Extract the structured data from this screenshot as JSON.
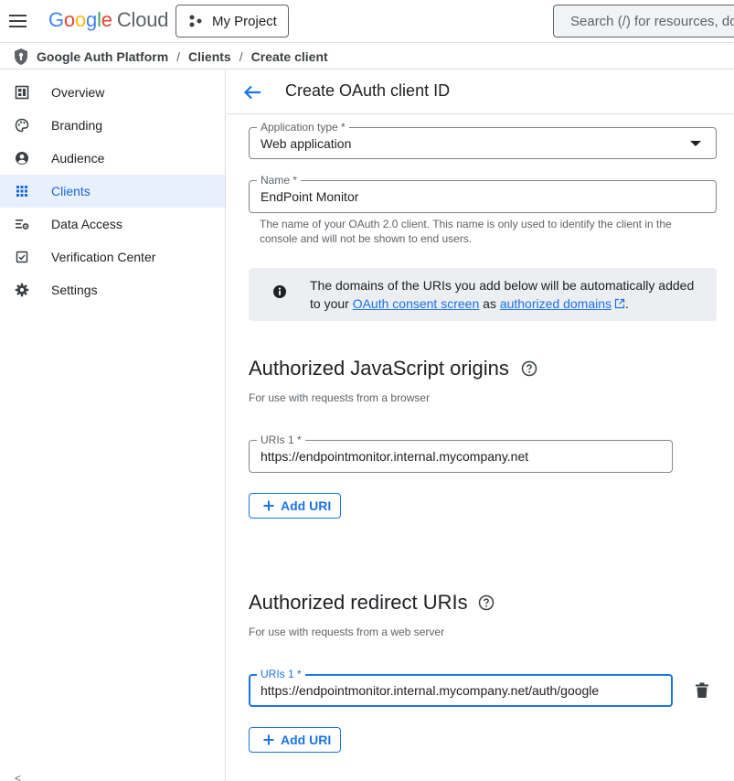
{
  "topbar": {
    "menu_icon": "hamburger-menu-icon",
    "logo_letters": [
      "G",
      "o",
      "o",
      "g",
      "l",
      "e"
    ],
    "logo_product": "Cloud",
    "project_label": "My Project",
    "search_placeholder": "Search (/) for resources, docs"
  },
  "breadcrumb": {
    "items": [
      "Google Auth Platform",
      "Clients",
      "Create client"
    ],
    "separator": "/"
  },
  "sidebar": {
    "items": [
      {
        "label": "Overview",
        "icon": "dashboard-icon",
        "active": false
      },
      {
        "label": "Branding",
        "icon": "palette-icon",
        "active": false
      },
      {
        "label": "Audience",
        "icon": "account-circle-icon",
        "active": false
      },
      {
        "label": "Clients",
        "icon": "apps-grid-icon",
        "active": true
      },
      {
        "label": "Data Access",
        "icon": "tune-settings-icon",
        "active": false
      },
      {
        "label": "Verification Center",
        "icon": "verified-checkbox-icon",
        "active": false
      },
      {
        "label": "Settings",
        "icon": "gear-icon",
        "active": false
      }
    ],
    "collapse_glyph": "<"
  },
  "page": {
    "title": "Create OAuth client ID"
  },
  "form": {
    "app_type": {
      "label": "Application type *",
      "value": "Web application"
    },
    "name": {
      "label": "Name *",
      "value": "EndPoint Monitor",
      "helper_line1": "The name of your OAuth 2.0 client. This name is only used to identify the client in the",
      "helper_line2": "console and will not be shown to end users."
    },
    "info": {
      "line1": "The domains of the URIs you add below will be automatically added",
      "line2_prefix": "to your ",
      "link1": "OAuth consent screen",
      "middle": " as ",
      "link2": "authorized domains",
      "suffix": "."
    },
    "js_origins": {
      "title": "Authorized JavaScript origins",
      "subtitle": "For use with requests from a browser",
      "uri_label": "URIs 1 *",
      "uri_value": "https://endpointmonitor.internal.mycompany.net",
      "add_label": "Add URI"
    },
    "redirect_uris": {
      "title": "Authorized redirect URIs",
      "subtitle": "For use with requests from a web server",
      "uri_label": "URIs 1 *",
      "uri_value": "https://endpointmonitor.internal.mycompany.net/auth/google",
      "add_label": "Add URI"
    }
  },
  "colors": {
    "accent": "#1a73e8",
    "active_bg": "#e8f0fe",
    "border": "#dadce0"
  }
}
